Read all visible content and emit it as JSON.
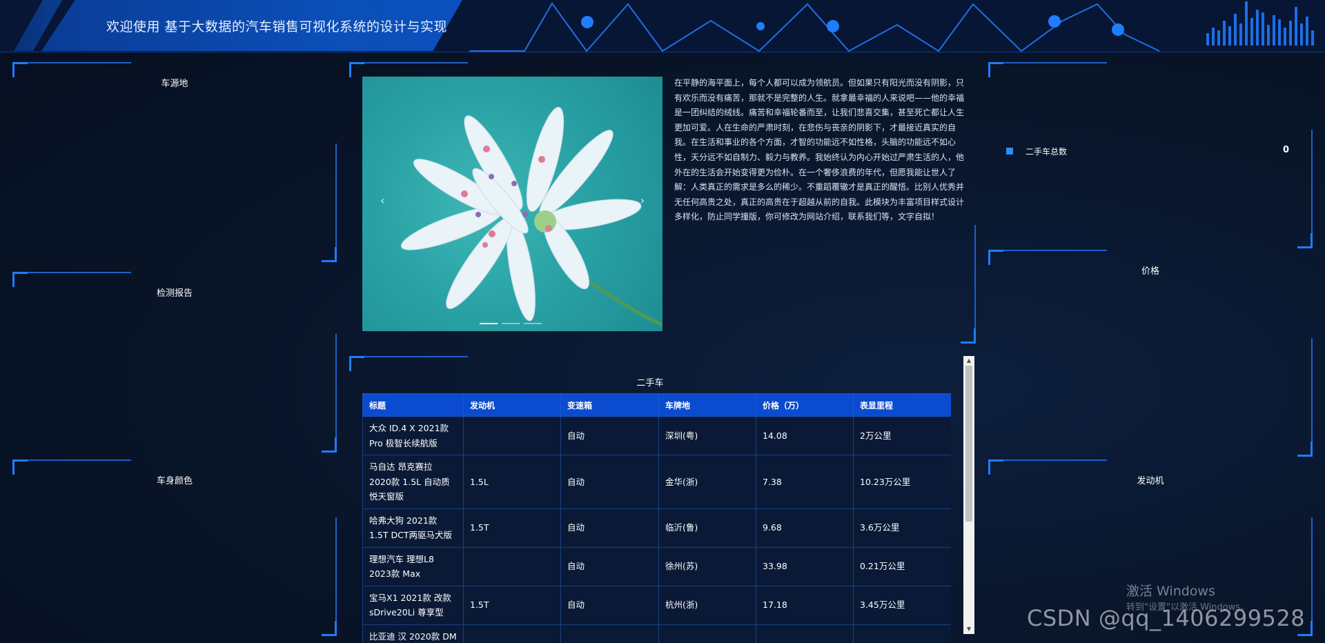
{
  "header": {
    "title": "欢迎使用 基于大数据的汽车销售可视化系统的设计与实现"
  },
  "left_panels": {
    "origin_title": "车源地",
    "report_title": "检测报告",
    "color_title": "车身颜色"
  },
  "carousel": {
    "prev_label": "‹",
    "next_label": "›",
    "slide_count": 3,
    "active_index": 0
  },
  "intro": {
    "text": "在平静的海平面上，每个人都可以成为领航员。但如果只有阳光而没有阴影，只有欢乐而没有痛苦，那就不是完整的人生。就拿最幸福的人来说吧——他的幸福是一团纠结的绒线。痛苦和幸福轮番而至，让我们悲喜交集，甚至死亡都让人生更加可爱。人在生命的严肃时刻，在悲伤与丧亲的阴影下，才最接近真实的自我。在生活和事业的各个方面，才智的功能远不如性格，头脑的功能远不如心性，天分远不如自制力、毅力与教养。我始终认为内心开始过严肃生活的人，他外在的生活会开始变得更为俭朴。在一个奢侈浪费的年代，但愿我能让世人了解：人类真正的需求是多么的稀少。不重蹈覆辙才是真正的醒悟。比别人优秀并无任何高贵之处，真正的高贵在于超越从前的自我。此模块为丰富项目样式设计多样化，防止同学撞版，你可修改为网站介绍，联系我们等，文字自拟！"
  },
  "stats": {
    "label": "二手车总数",
    "value": "0"
  },
  "right_panels": {
    "price_title": "价格",
    "engine_title": "发动机"
  },
  "table": {
    "title": "二手车",
    "columns": [
      "标题",
      "发动机",
      "变速箱",
      "车牌地",
      "价格（万）",
      "表显里程"
    ],
    "rows": [
      [
        "大众 ID.4 X 2021款 Pro 极智长续航版",
        "",
        "自动",
        "深圳(粤)",
        "14.08",
        "2万公里"
      ],
      [
        "马自达 昂克赛拉 2020款 1.5L 自动质悦天窗版",
        "1.5L",
        "自动",
        "金华(浙)",
        "7.38",
        "10.23万公里"
      ],
      [
        "哈弗大狗 2021款 1.5T DCT两驱马犬版",
        "1.5T",
        "自动",
        "临沂(鲁)",
        "9.68",
        "3.6万公里"
      ],
      [
        "理想汽车 理想L8 2023款 Max",
        "",
        "自动",
        "徐州(苏)",
        "33.98",
        "0.21万公里"
      ],
      [
        "宝马X1 2021款 改款 sDrive20Li 尊享型",
        "1.5T",
        "自动",
        "杭州(浙)",
        "17.18",
        "3.45万公里"
      ],
      [
        "比亚迪 汉 2020款 DM",
        "",
        "",
        "",
        "",
        ""
      ]
    ]
  },
  "overlays": {
    "windows_line1": "激活 Windows",
    "windows_line2": "转到\"设置\"以激活 Windows。",
    "csdn": "CSDN @qq_1406299528"
  },
  "colors": {
    "background": "#081428",
    "accent": "#1f7dff",
    "table_header": "#0b4bcf",
    "stat_square": "#2a8ff0"
  }
}
